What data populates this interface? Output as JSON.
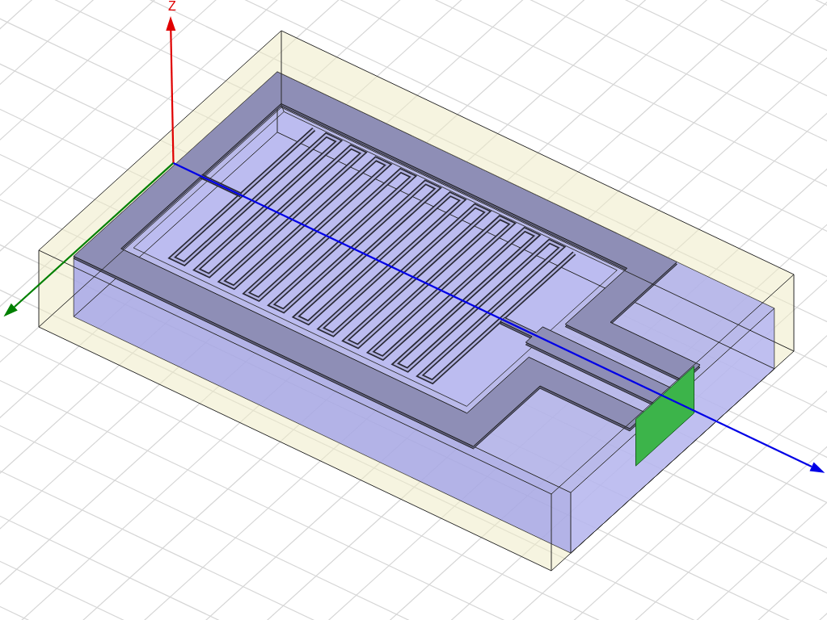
{
  "scene": {
    "parts": [
      {
        "kind": "air_box"
      },
      {
        "kind": "substrate"
      },
      {
        "kind": "metal_frame"
      },
      {
        "kind": "meander_line"
      },
      {
        "kind": "feed_line"
      },
      {
        "kind": "wave_port"
      }
    ],
    "axes": [
      {
        "kind": "z",
        "label": "Z",
        "color": "#e00000"
      },
      {
        "kind": "y",
        "color": "#008000"
      },
      {
        "kind": "x",
        "color": "#0000e6"
      }
    ]
  }
}
